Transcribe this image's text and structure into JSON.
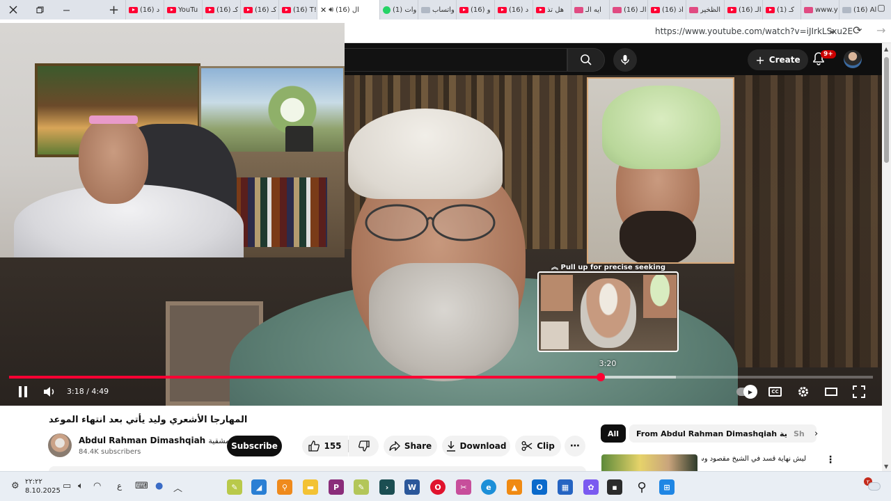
{
  "browser": {
    "tabs": [
      {
        "title": "(16) Al",
        "icon": "facebook"
      },
      {
        "title": "www.y",
        "icon": "youtube"
      },
      {
        "title": "(1) كـ",
        "icon": "youtube"
      },
      {
        "title": "(16) الـ",
        "icon": "youtube"
      },
      {
        "title": "الظخير",
        "icon": "youtube"
      },
      {
        "title": "(16) أذ",
        "icon": "youtube"
      },
      {
        "title": "(16) الـ",
        "icon": "youtube"
      },
      {
        "title": "ايه الـ",
        "icon": "youtube"
      },
      {
        "title": "هل تذ",
        "icon": "youtube"
      },
      {
        "title": "(16) د",
        "icon": "youtube"
      },
      {
        "title": "(16) و",
        "icon": "search"
      },
      {
        "title": "واتساب",
        "icon": "whatsapp"
      },
      {
        "title": "(1) وات",
        "icon": "whatsapp"
      }
    ],
    "active_tab": {
      "title": "(16) ال",
      "icon": "youtube"
    },
    "left_tabs": [
      {
        "title": "(16) T!",
        "icon": "youtube"
      },
      {
        "title": "(16) كـ",
        "icon": "youtube"
      },
      {
        "title": "(16) كـ",
        "icon": "youtube"
      },
      {
        "title": "YouTu",
        "icon": "youtube"
      },
      {
        "title": "(16) د",
        "icon": "youtube"
      }
    ],
    "url": "https://www.youtube.com/watch?v=iJIrkLSxu2E"
  },
  "youtube": {
    "create_label": "Create",
    "notification_count": "9+"
  },
  "player": {
    "current_time": "3:18",
    "duration": "4:49",
    "time_separator": " / ",
    "seek_hint": "Pull up for precise seeking",
    "seek_preview_time": "3:20",
    "played_fraction": 0.685,
    "buffered_fraction": 0.772,
    "cc_label": "CC"
  },
  "video": {
    "title": "المهارجا الأشعري وليد يأتي بعد انتهاء الموعد",
    "channel_name": "Abdul Rahman Dimashqiah",
    "channel_name_ar": "دمشقية",
    "subscribers": "84.4K subscribers",
    "subscribe_label": "Subscribe",
    "like_count": "155",
    "share_label": "Share",
    "download_label": "Download",
    "clip_label": "Clip"
  },
  "sidebar": {
    "chips": [
      {
        "label": "All",
        "active": true
      },
      {
        "label": "From Abdul Rahman Dimashqiah دمشقية",
        "active": false
      },
      {
        "label": "Sh",
        "active": false
      }
    ],
    "recommended_title": "ليش نهاية قسد في الشيخ مقصود وسوريا"
  },
  "taskbar": {
    "time": "٢٢:٢٢",
    "date": "8.10.2025",
    "lang": "ع",
    "notification_badge": "٢"
  },
  "colors": {
    "youtube_red": "#ff0033",
    "youtube_dark": "#0f0f0f",
    "chip_gray": "#f2f2f2"
  }
}
